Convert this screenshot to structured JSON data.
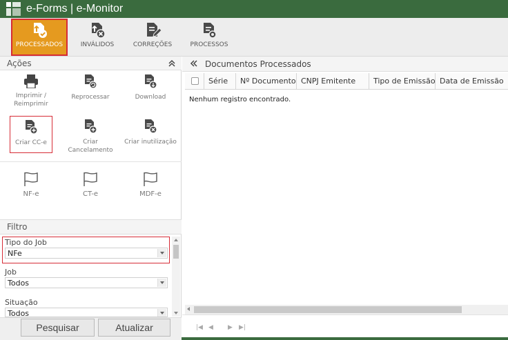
{
  "app": {
    "title": "e-Forms | e-Monitor"
  },
  "toolbar": {
    "items": [
      {
        "label": "PROCESSADOS",
        "icon": "doc-check-icon",
        "active": true
      },
      {
        "label": "INVÁLIDOS",
        "icon": "doc-x-icon",
        "active": false
      },
      {
        "label": "CORREÇÕES",
        "icon": "doc-edit-icon",
        "active": false
      },
      {
        "label": "PROCESSOS",
        "icon": "doc-gear-icon",
        "active": false
      }
    ]
  },
  "actions": {
    "title": "Ações",
    "items": [
      {
        "label": "Imprimir /\nReimprimir",
        "icon": "printer-icon"
      },
      {
        "label": "Reprocessar",
        "icon": "doc-refresh-icon"
      },
      {
        "label": "Download",
        "icon": "doc-download-icon"
      },
      {
        "label": "Criar CC-e",
        "icon": "doc-add-icon"
      },
      {
        "label": "Criar\nCancelamento",
        "icon": "doc-add-icon"
      },
      {
        "label": "Criar inutilização",
        "icon": "doc-x-icon"
      }
    ],
    "docs": [
      {
        "label": "NF-e",
        "icon": "flag-icon"
      },
      {
        "label": "CT-e",
        "icon": "flag-icon"
      },
      {
        "label": "MDF-e",
        "icon": "flag-icon"
      }
    ]
  },
  "filter": {
    "title": "Filtro",
    "fields": [
      {
        "label": "Tipo do Job",
        "value": "NFe"
      },
      {
        "label": "Job",
        "value": "Todos"
      },
      {
        "label": "Situação",
        "value": "Todos"
      }
    ],
    "search_label": "Pesquisar",
    "refresh_label": "Atualizar"
  },
  "documents": {
    "title": "Documentos Processados",
    "columns": [
      "Série",
      "Nº Documento",
      "CNPJ Emitente",
      "Tipo de Emissão",
      "Data de Emissão"
    ],
    "empty_message": "Nenhum registro encontrado."
  },
  "colors": {
    "brand_green": "#3a6b3e",
    "active_orange": "#e59a1f",
    "highlight_red": "#d62b35"
  }
}
